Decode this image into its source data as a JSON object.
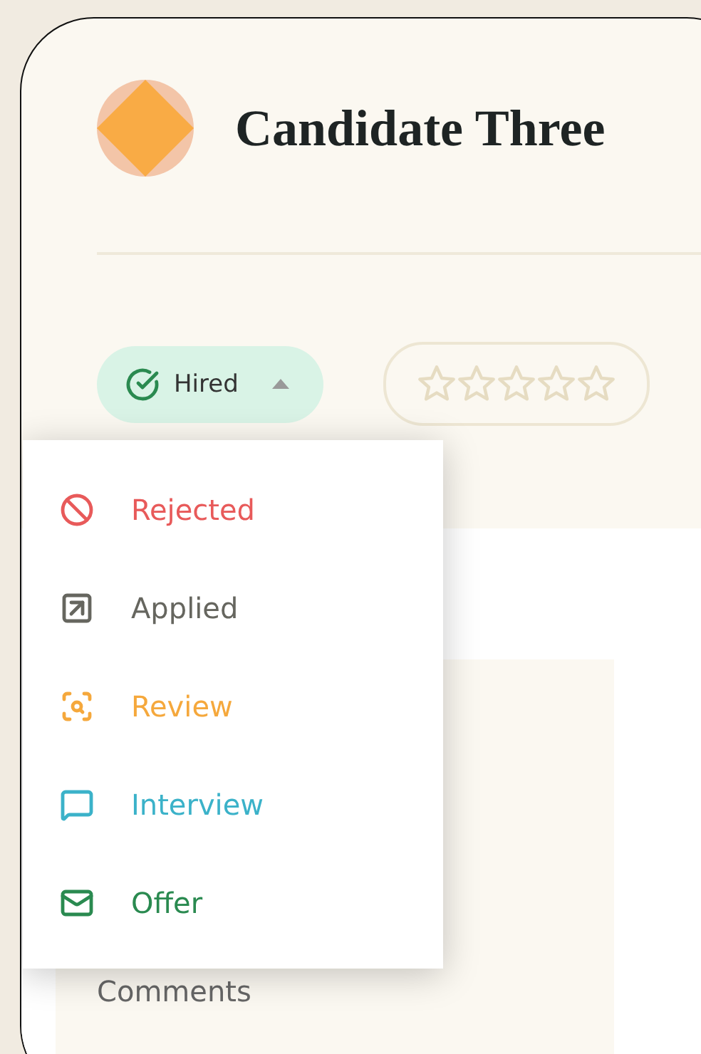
{
  "candidate": {
    "name": "Candidate Three"
  },
  "status_pill": {
    "label": "Hired",
    "expanded": true
  },
  "rating": {
    "stars": 0
  },
  "status_menu": [
    {
      "kind": "rejected",
      "label": "Rejected",
      "color": "#e85a5a"
    },
    {
      "kind": "applied",
      "label": "Applied",
      "color": "#66665f"
    },
    {
      "kind": "review",
      "label": "Review",
      "color": "#f5a83c"
    },
    {
      "kind": "interview",
      "label": "Interview",
      "color": "#3bb2c9"
    },
    {
      "kind": "offer",
      "label": "Offer",
      "color": "#2a8a50"
    }
  ],
  "section": {
    "title": "Comments"
  }
}
